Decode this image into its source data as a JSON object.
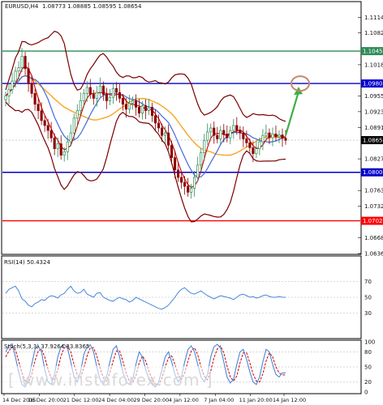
{
  "header": {
    "symbol": "EURUSD,H4",
    "ohlc": "1.08773 1.08885 1.08595 1.08654"
  },
  "watermark": "[ www.instaforex.com ]",
  "chart_data": [
    {
      "type": "candlestick",
      "panel": "price",
      "ylim": [
        1.0636,
        1.1144
      ],
      "y_ticks": [
        "1.11140",
        "1.10825",
        "1.10180",
        "1.09550",
        "1.09230",
        "1.08910",
        "1.08275",
        "1.07635",
        "1.07320",
        "1.06680",
        "1.06360"
      ],
      "x_labels": [
        "14 Dec 2015",
        "16 Dec 20:00",
        "21 Dec 12:00",
        "24 Dec 04:00",
        "29 Dec 20:00",
        "4 Jan 12:00",
        "7 Jan 04:00",
        "11 Jan 20:00",
        "14 Jan 12:00"
      ],
      "close": [
        1.0955,
        1.0968,
        1.0985,
        1.1005,
        1.1012,
        1.1035,
        1.101,
        1.098,
        1.096,
        1.0938,
        1.0925,
        1.0905,
        1.0895,
        1.0885,
        1.087,
        1.0848,
        1.0858,
        1.0835,
        1.0842,
        1.0862,
        1.088,
        1.091,
        1.0925,
        1.0945,
        1.096,
        1.0972,
        1.0958,
        1.095,
        1.0962,
        1.0975,
        1.0958,
        1.0945,
        1.0952,
        1.097,
        1.0962,
        1.095,
        1.0938,
        1.0928,
        1.094,
        1.0945,
        1.0932,
        1.092,
        1.0935,
        1.0925,
        1.0932,
        1.0915,
        1.09,
        1.089,
        1.0875,
        1.088,
        1.0855,
        1.083,
        1.0805,
        1.079,
        1.078,
        1.0772,
        1.076,
        1.0768,
        1.079,
        1.0815,
        1.084,
        1.0865,
        1.0882,
        1.089,
        1.0875,
        1.0868,
        1.0885,
        1.0878,
        1.087,
        1.0885,
        1.0895,
        1.0885,
        1.088,
        1.0868,
        1.086,
        1.085,
        1.0838,
        1.0848,
        1.0862,
        1.0875,
        1.088,
        1.087,
        1.0878,
        1.0872,
        1.0876,
        1.0869,
        1.0865
      ],
      "horizontal_levels": [
        {
          "value": 1.10455,
          "label": "1.10455",
          "color": "#2e8b57"
        },
        {
          "value": 1.098,
          "label": "1.09800",
          "color": "#0000cd"
        },
        {
          "value": 1.08003,
          "label": "1.08003",
          "color": "#0000cd"
        },
        {
          "value": 1.07022,
          "label": "1.07022",
          "color": "#ff0000"
        }
      ],
      "current_price": {
        "value": 1.08654,
        "label": "1.08654"
      },
      "target_level": 1.098,
      "colors": {
        "bull": "#2e8b57",
        "bear": "#8b0000",
        "ma_fast": "#cc0000",
        "ma_mid": "#4169e1",
        "ma_slow": "#f5a623",
        "bands": "#7a0000",
        "arrow": "#3cb043",
        "target_circle": "#c8876a"
      }
    },
    {
      "type": "line",
      "panel": "indicator",
      "name": "RSI(14) 50.4324",
      "ylim": [
        0,
        100
      ],
      "y_ticks": [
        "70",
        "50",
        "30"
      ],
      "values": [
        55,
        60,
        62,
        64,
        58,
        48,
        45,
        40,
        38,
        42,
        44,
        47,
        46,
        50,
        52,
        51,
        49,
        53,
        55,
        60,
        64,
        58,
        55,
        56,
        60,
        54,
        52,
        50,
        55,
        56,
        50,
        48,
        46,
        45,
        48,
        50,
        48,
        47,
        44,
        46,
        50,
        48,
        46,
        44,
        42,
        40,
        38,
        36,
        35,
        37,
        40,
        45,
        50,
        56,
        60,
        62,
        58,
        55,
        54,
        56,
        58,
        55,
        52,
        50,
        48,
        50,
        52,
        51,
        50,
        49,
        47,
        50,
        53,
        54,
        52,
        50,
        51,
        49,
        50,
        52,
        53,
        51,
        50,
        50,
        51,
        50,
        50
      ],
      "color": "#4a86d8"
    },
    {
      "type": "line",
      "panel": "indicator",
      "name": "Stoch(5,3,3) 37.9264 33.8365",
      "ylim": [
        0,
        100
      ],
      "y_ticks": [
        "100",
        "80",
        "50",
        "20",
        "0"
      ],
      "main": [
        80,
        92,
        96,
        70,
        40,
        15,
        10,
        25,
        55,
        85,
        92,
        80,
        45,
        20,
        15,
        35,
        70,
        90,
        95,
        88,
        60,
        30,
        20,
        40,
        75,
        90,
        94,
        80,
        50,
        25,
        15,
        30,
        60,
        85,
        92,
        70,
        40,
        20,
        15,
        25,
        55,
        80,
        70,
        45,
        25,
        15,
        10,
        20,
        45,
        70,
        80,
        60,
        35,
        20,
        30,
        60,
        85,
        92,
        80,
        55,
        30,
        20,
        35,
        70,
        90,
        95,
        88,
        60,
        30,
        18,
        25,
        55,
        80,
        85,
        65,
        40,
        20,
        15,
        30,
        60,
        85,
        80,
        55,
        35,
        30,
        38,
        38
      ],
      "signal": [
        70,
        82,
        90,
        84,
        62,
        38,
        22,
        18,
        35,
        62,
        82,
        86,
        70,
        45,
        28,
        25,
        45,
        72,
        88,
        92,
        80,
        55,
        34,
        28,
        48,
        72,
        88,
        88,
        72,
        48,
        28,
        22,
        38,
        62,
        82,
        82,
        62,
        38,
        22,
        18,
        32,
        58,
        72,
        62,
        42,
        26,
        16,
        14,
        28,
        50,
        68,
        72,
        55,
        35,
        25,
        38,
        62,
        82,
        88,
        74,
        50,
        32,
        24,
        42,
        68,
        86,
        92,
        78,
        52,
        30,
        22,
        32,
        58,
        78,
        78,
        58,
        36,
        22,
        20,
        36,
        62,
        78,
        70,
        50,
        38,
        34,
        34
      ],
      "colors": {
        "main": "#4a86d8",
        "signal": "#cc0000"
      }
    }
  ]
}
